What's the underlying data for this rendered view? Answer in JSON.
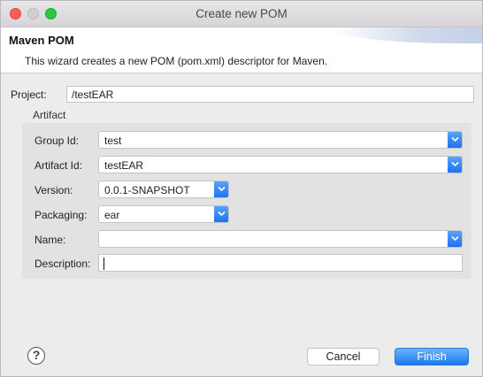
{
  "window": {
    "title": "Create new POM"
  },
  "banner": {
    "title": "Maven POM",
    "description": "This wizard creates a new POM (pom.xml) descriptor for Maven."
  },
  "project": {
    "label": "Project:",
    "value": "/testEAR"
  },
  "artifact": {
    "section_label": "Artifact",
    "group_id": {
      "label": "Group Id:",
      "value": "test"
    },
    "artifact_id": {
      "label": "Artifact Id:",
      "value": "testEAR"
    },
    "version": {
      "label": "Version:",
      "value": "0.0.1-SNAPSHOT"
    },
    "packaging": {
      "label": "Packaging:",
      "value": "ear"
    },
    "name": {
      "label": "Name:",
      "value": ""
    },
    "description": {
      "label": "Description:",
      "value": ""
    }
  },
  "footer": {
    "help_icon": "help-icon",
    "cancel_label": "Cancel",
    "finish_label": "Finish"
  },
  "colors": {
    "accent": "#1b78f2",
    "close": "#fc5f57",
    "maximize": "#2ac840"
  }
}
